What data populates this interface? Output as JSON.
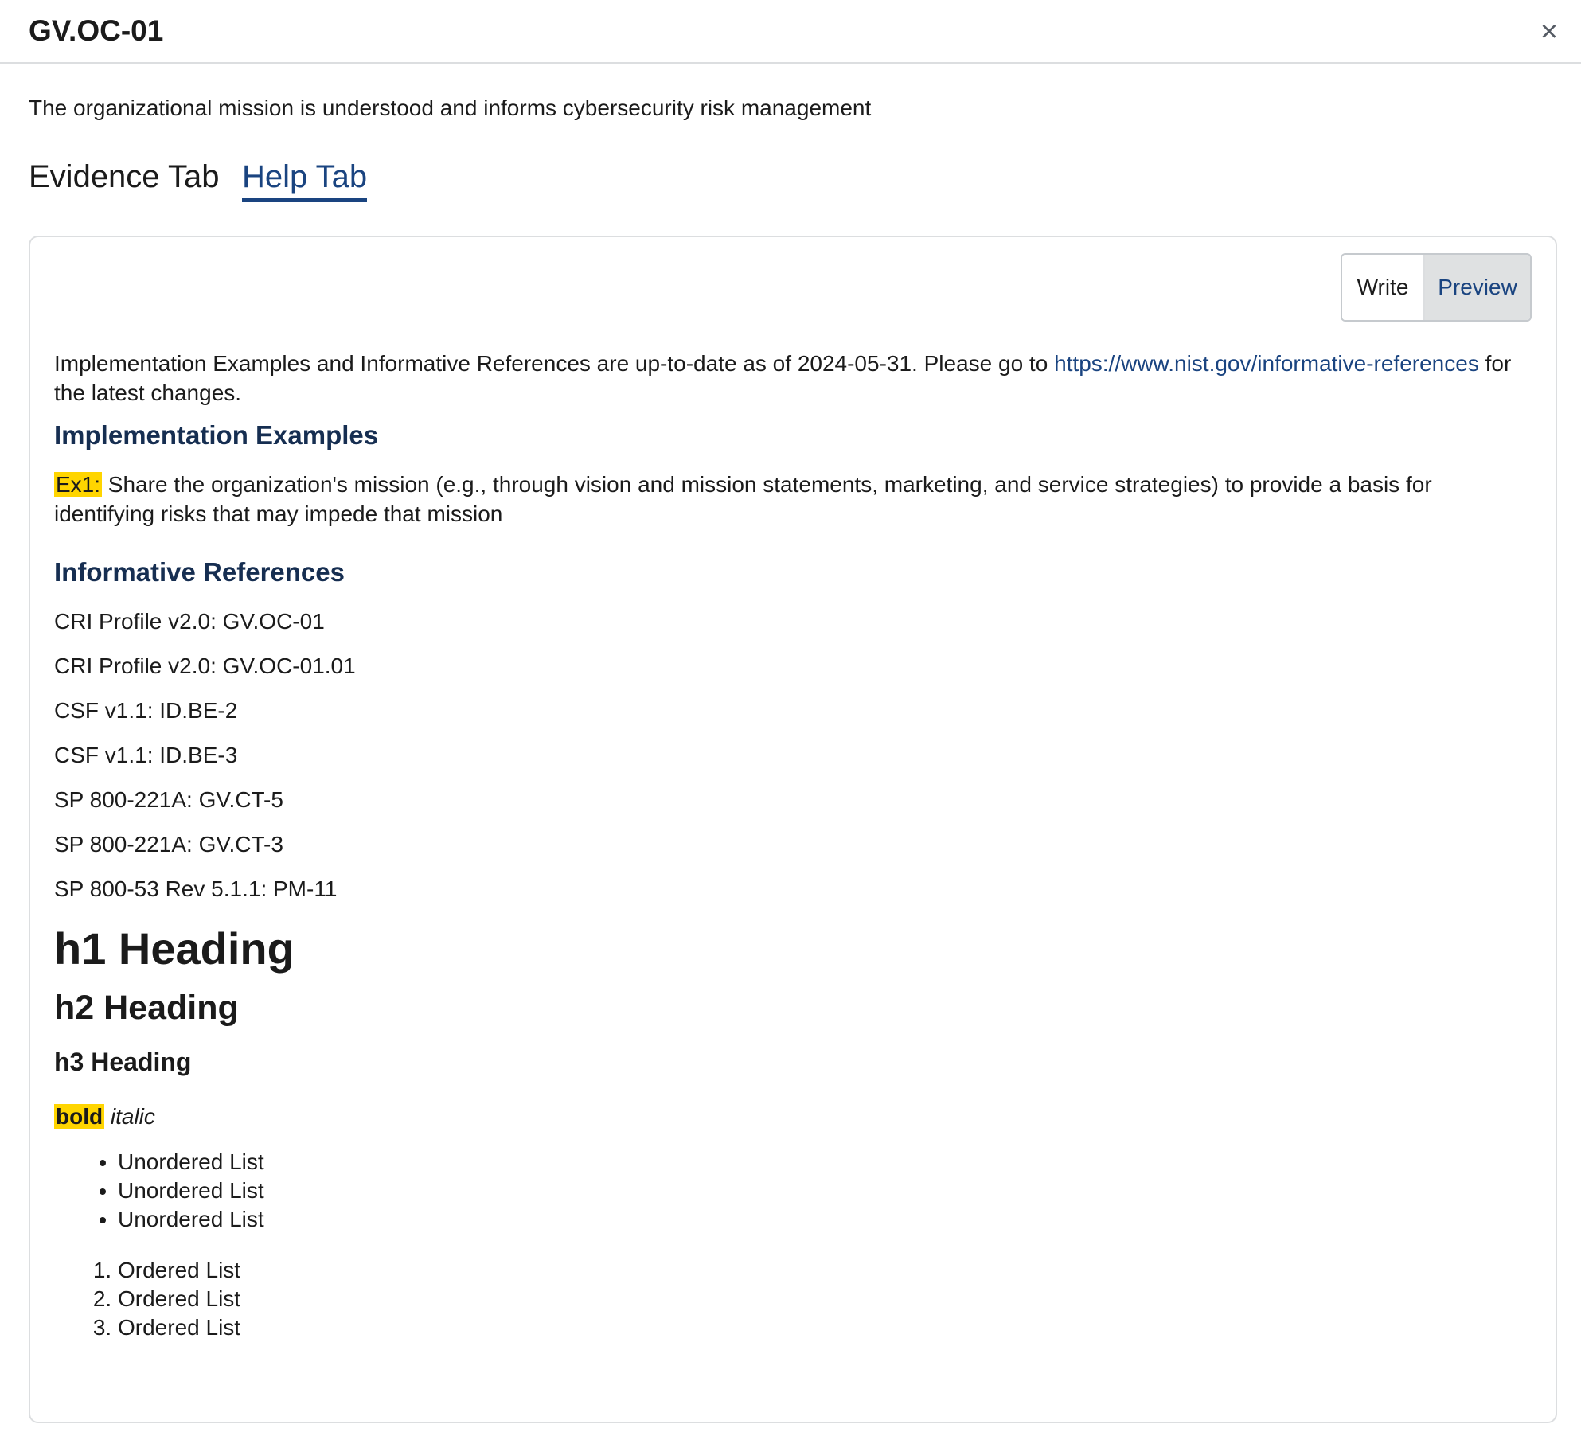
{
  "header": {
    "title": "GV.OC-01",
    "close_label": "×"
  },
  "subtitle": "The organizational mission is understood and informs cybersecurity risk management",
  "tabs": [
    {
      "label": "Evidence Tab",
      "active": false
    },
    {
      "label": "Help Tab",
      "active": true
    }
  ],
  "editor": {
    "write_label": "Write",
    "preview_label": "Preview",
    "intro_prefix": "Implementation Examples and Informative References are up-to-date as of 2024-05-31. Please go to ",
    "intro_link": "https://www.nist.gov/informative-references",
    "intro_suffix": " for the latest changes.",
    "impl_heading": "Implementation Examples",
    "ex1_label": "Ex1:",
    "ex1_text": " Share the organization's mission (e.g., through vision and mission statements, marketing, and service strategies) to provide a basis for identifying risks that may impede that mission",
    "refs_heading": "Informative References",
    "refs": [
      "CRI Profile v2.0: GV.OC-01",
      "CRI Profile v2.0: GV.OC-01.01",
      "CSF v1.1: ID.BE-2",
      "CSF v1.1: ID.BE-3",
      "SP 800-221A: GV.CT-5",
      "SP 800-221A: GV.CT-3",
      "SP 800-53 Rev 5.1.1: PM-11"
    ],
    "h1": "h1 Heading",
    "h2": "h2 Heading",
    "h3": "h3 Heading",
    "bold": "bold",
    "italic": "italic",
    "unordered": [
      "Unordered List",
      "Unordered List",
      "Unordered List"
    ],
    "ordered": [
      "Ordered List",
      "Ordered List",
      "Ordered List"
    ]
  },
  "colors": {
    "link": "#1a4480",
    "section_heading": "#162e51",
    "highlight": "#ffd500",
    "tab_underline": "#1a4480"
  }
}
